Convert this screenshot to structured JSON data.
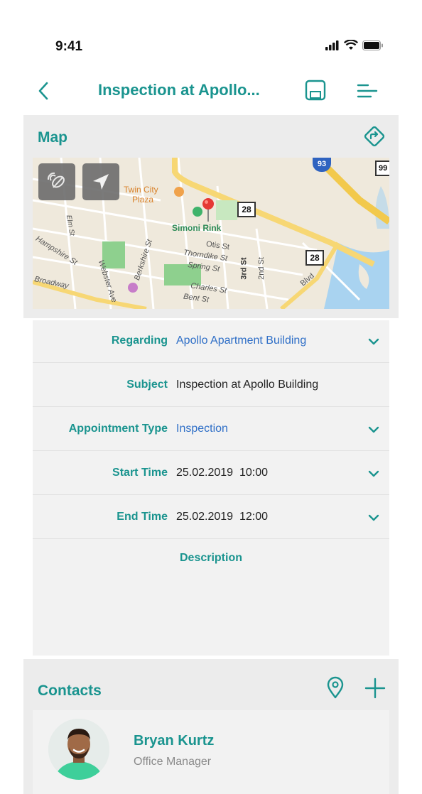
{
  "status_bar": {
    "time": "9:41"
  },
  "nav": {
    "title": "Inspection at Apollo..."
  },
  "map_section": {
    "title": "Map",
    "labels": {
      "twin_city": "Twin City",
      "plaza": "Plaza",
      "simoni_rink": "Simoni Rink",
      "otis": "Otis St",
      "thorndike": "Thorndike St",
      "spring": "Spring St",
      "charles": "Charles St",
      "bent": "Bent St",
      "elm": "Elm St",
      "hampshire": "Hampshire St",
      "webster": "Webster Ave",
      "berkshire": "Berkshire St",
      "third": "3rd St",
      "second": "2nd St",
      "broadway": "Broadway",
      "blvd": "Blvd",
      "shield_28a": "28",
      "shield_28b": "28",
      "shield_93": "93",
      "shield_99": "99"
    }
  },
  "form": {
    "rows": [
      {
        "label": "Regarding",
        "value": "Apollo Apartment Building"
      },
      {
        "label": "Subject",
        "value": "Inspection at Apollo Building"
      },
      {
        "label": "Appointment Type",
        "value": "Inspection"
      },
      {
        "label": "Start Time",
        "value": "25.02.2019  10:00"
      },
      {
        "label": "End Time",
        "value": "25.02.2019  12:00"
      }
    ],
    "description_label": "Description",
    "description_value": ""
  },
  "contacts": {
    "title": "Contacts",
    "items": [
      {
        "name": "Bryan Kurtz",
        "role": "Office Manager"
      }
    ]
  },
  "colors": {
    "accent": "#1a948f",
    "link": "#2f6fc7",
    "panel_bg": "#ececec",
    "card_bg": "#f2f2f2",
    "pin": "#e53935",
    "park": "#8ed08e"
  },
  "icons": [
    "signal-icon",
    "wifi-icon",
    "battery-icon",
    "back-chevron-icon",
    "save-icon",
    "menu-icon",
    "directions-icon",
    "map-satellite-icon",
    "location-arrow-icon",
    "map-pin-icon",
    "chevron-down-icon",
    "location-pin-icon",
    "plus-icon"
  ]
}
